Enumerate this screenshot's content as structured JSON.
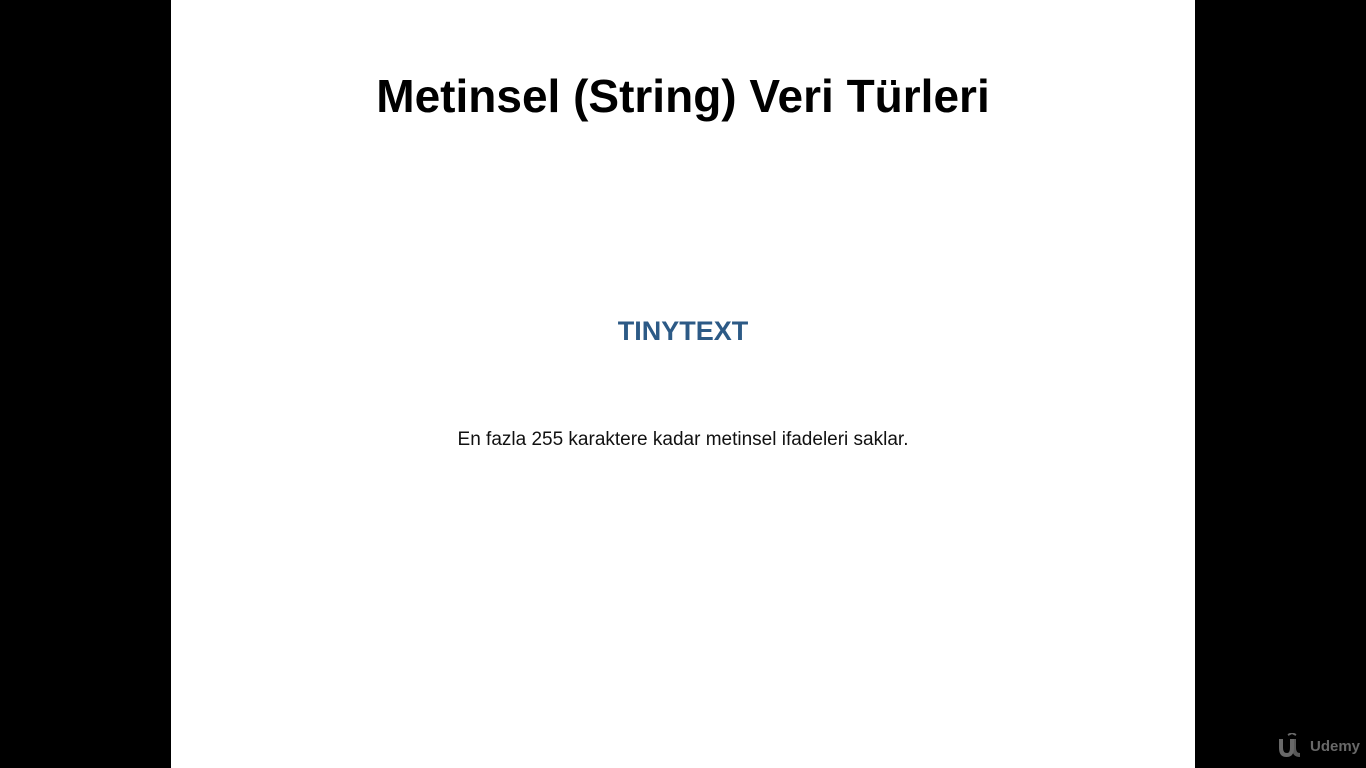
{
  "slide": {
    "title": "Metinsel (String) Veri Türleri",
    "heading": "TINYTEXT",
    "body": "En fazla 255 karaktere kadar metinsel ifadeleri saklar."
  },
  "watermark": {
    "brand": "Udemy",
    "icon": "udemy-logo-icon"
  },
  "colors": {
    "background": "#000000",
    "slide": "#ffffff",
    "title": "#000000",
    "heading": "#2c5a86",
    "body": "#111111",
    "watermark": "#bdbdbd"
  }
}
